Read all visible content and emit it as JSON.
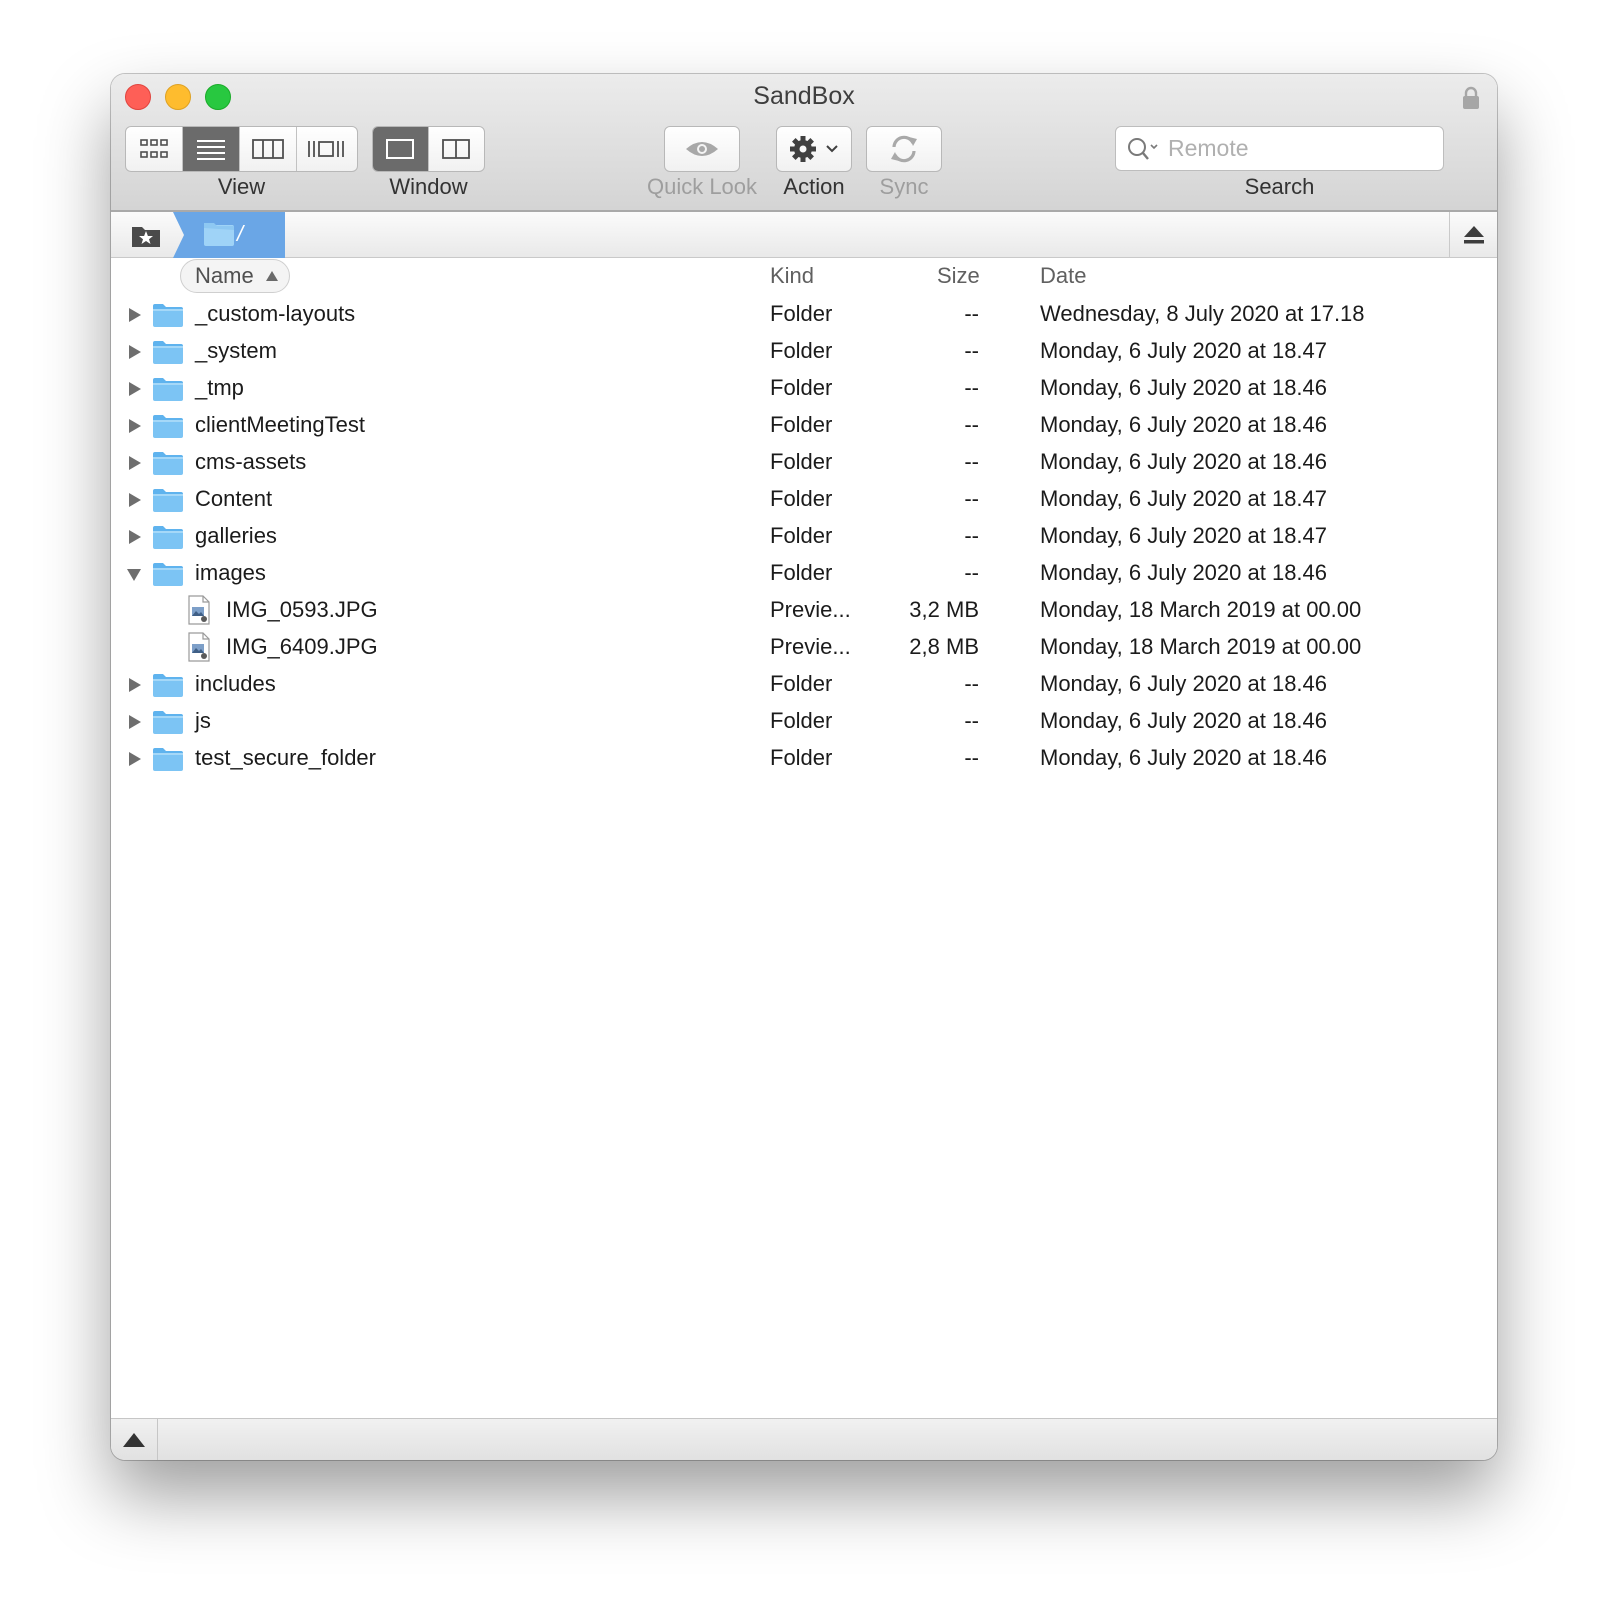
{
  "window": {
    "title": "SandBox"
  },
  "toolbar": {
    "view": {
      "label": "View",
      "buttons": [
        {
          "name": "icon-view-button",
          "icon": "grid-icon",
          "selected": false
        },
        {
          "name": "list-view-button",
          "icon": "list-icon",
          "selected": true
        },
        {
          "name": "column-view-button",
          "icon": "columns-icon",
          "selected": false
        },
        {
          "name": "coverflow-view-button",
          "icon": "coverflow-icon",
          "selected": false
        }
      ]
    },
    "window_mode": {
      "label": "Window",
      "buttons": [
        {
          "name": "single-pane-button",
          "icon": "single-pane-icon",
          "selected": true
        },
        {
          "name": "dual-pane-button",
          "icon": "dual-pane-icon",
          "selected": false
        }
      ]
    },
    "quick_look": {
      "label": "Quick Look",
      "icon": "eye-icon",
      "enabled": false
    },
    "action": {
      "label": "Action",
      "icon": "gear-icon"
    },
    "sync": {
      "label": "Sync",
      "icon": "sync-icon",
      "enabled": false
    },
    "search": {
      "label": "Search",
      "placeholder": "Remote",
      "icon": "search-icon"
    }
  },
  "pathbar": {
    "current_path": "/"
  },
  "columns": {
    "name": "Name",
    "kind": "Kind",
    "size": "Size",
    "date": "Date",
    "sort": "ascending"
  },
  "rows": [
    {
      "name": "_custom-layouts",
      "kind": "Folder",
      "size": "--",
      "date": "Wednesday, 8 July 2020 at 17.18",
      "type": "folder",
      "expanded": false
    },
    {
      "name": "_system",
      "kind": "Folder",
      "size": "--",
      "date": "Monday, 6 July 2020 at 18.47",
      "type": "folder",
      "expanded": false
    },
    {
      "name": "_tmp",
      "kind": "Folder",
      "size": "--",
      "date": "Monday, 6 July 2020 at 18.46",
      "type": "folder",
      "expanded": false
    },
    {
      "name": "clientMeetingTest",
      "kind": "Folder",
      "size": "--",
      "date": "Monday, 6 July 2020 at 18.46",
      "type": "folder",
      "expanded": false
    },
    {
      "name": "cms-assets",
      "kind": "Folder",
      "size": "--",
      "date": "Monday, 6 July 2020 at 18.46",
      "type": "folder",
      "expanded": false
    },
    {
      "name": "Content",
      "kind": "Folder",
      "size": "--",
      "date": "Monday, 6 July 2020 at 18.47",
      "type": "folder",
      "expanded": false
    },
    {
      "name": "galleries",
      "kind": "Folder",
      "size": "--",
      "date": "Monday, 6 July 2020 at 18.47",
      "type": "folder",
      "expanded": false
    },
    {
      "name": "images",
      "kind": "Folder",
      "size": "--",
      "date": "Monday, 6 July 2020 at 18.46",
      "type": "folder",
      "expanded": true
    },
    {
      "name": "IMG_0593.JPG",
      "kind": "Previe...",
      "size": "3,2 MB",
      "date": "Monday, 18 March 2019 at 00.00",
      "type": "file"
    },
    {
      "name": "IMG_6409.JPG",
      "kind": "Previe...",
      "size": "2,8 MB",
      "date": "Monday, 18 March 2019 at 00.00",
      "type": "file"
    },
    {
      "name": "includes",
      "kind": "Folder",
      "size": "--",
      "date": "Monday, 6 July 2020 at 18.46",
      "type": "folder",
      "expanded": false
    },
    {
      "name": "js",
      "kind": "Folder",
      "size": "--",
      "date": "Monday, 6 July 2020 at 18.46",
      "type": "folder",
      "expanded": false
    },
    {
      "name": "test_secure_folder",
      "kind": "Folder",
      "size": "--",
      "date": "Monday, 6 July 2020 at 18.46",
      "type": "folder",
      "expanded": false
    }
  ],
  "colors": {
    "folder": "#7cc4f4",
    "path_crumb": "#6aa6e6",
    "close": "#fe5f57",
    "minimize": "#febc2e",
    "maximize": "#28c840"
  }
}
